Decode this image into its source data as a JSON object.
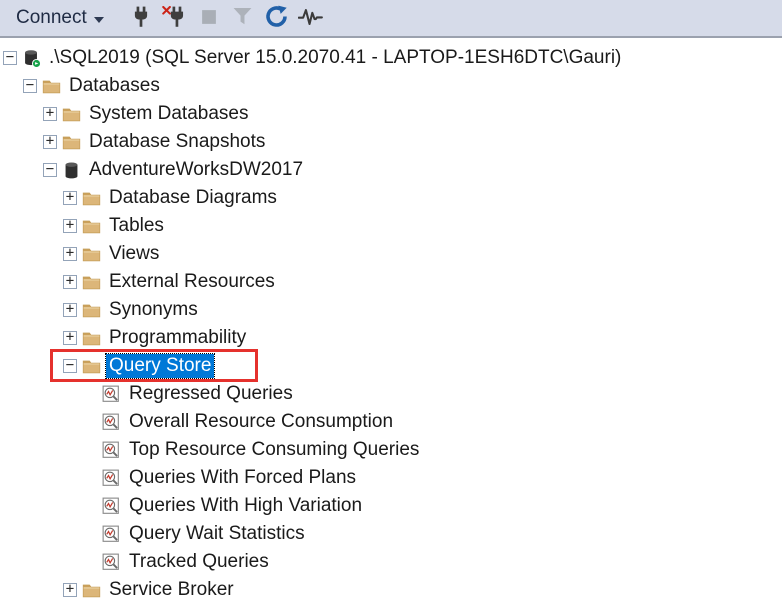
{
  "toolbar": {
    "connect_label": "Connect",
    "buttons": [
      {
        "name": "connect-button",
        "type": "dropdown",
        "label": "Connect",
        "disabled": false
      },
      {
        "name": "connect-object-explorer-button",
        "icon": "plug-icon",
        "disabled": false
      },
      {
        "name": "disconnect-object-explorer-button",
        "icon": "plug-disconnect-icon",
        "disabled": false
      },
      {
        "name": "stop-button",
        "icon": "stop-icon",
        "disabled": true
      },
      {
        "name": "filter-button",
        "icon": "filter-icon",
        "disabled": true
      },
      {
        "name": "refresh-button",
        "icon": "refresh-icon",
        "disabled": false
      },
      {
        "name": "activity-monitor-button",
        "icon": "activity-pulse-icon",
        "disabled": false
      }
    ]
  },
  "colors": {
    "toolbar_bg": "#D6DBE9",
    "selection_bg": "#0078D7",
    "selection_text": "#FFFFFF",
    "annotation_red": "#E5312D",
    "folder_tan": "#DCB679",
    "refresh_blue": "#2160A8"
  },
  "tree": {
    "rows": [
      {
        "level": 0,
        "expand": "minus",
        "icon": "server",
        "label": ".\\SQL2019 (SQL Server 15.0.2070.41 - LAPTOP-1ESH6DTC\\Gauri)"
      },
      {
        "level": 1,
        "expand": "minus",
        "icon": "folder",
        "label": "Databases"
      },
      {
        "level": 2,
        "expand": "plus",
        "icon": "folder",
        "label": "System Databases"
      },
      {
        "level": 2,
        "expand": "plus",
        "icon": "folder",
        "label": "Database Snapshots"
      },
      {
        "level": 2,
        "expand": "minus",
        "icon": "database",
        "label": "AdventureWorksDW2017"
      },
      {
        "level": 3,
        "expand": "plus",
        "icon": "folder",
        "label": "Database Diagrams"
      },
      {
        "level": 3,
        "expand": "plus",
        "icon": "folder",
        "label": "Tables"
      },
      {
        "level": 3,
        "expand": "plus",
        "icon": "folder",
        "label": "Views"
      },
      {
        "level": 3,
        "expand": "plus",
        "icon": "folder",
        "label": "External Resources"
      },
      {
        "level": 3,
        "expand": "plus",
        "icon": "folder",
        "label": "Synonyms"
      },
      {
        "level": 3,
        "expand": "plus",
        "icon": "folder",
        "label": "Programmability"
      },
      {
        "level": 3,
        "expand": "minus",
        "icon": "folder",
        "label": "Query Store",
        "selected": true,
        "annotated": true
      },
      {
        "level": 4,
        "expand": "none",
        "icon": "report",
        "label": "Regressed Queries"
      },
      {
        "level": 4,
        "expand": "none",
        "icon": "report",
        "label": "Overall Resource Consumption"
      },
      {
        "level": 4,
        "expand": "none",
        "icon": "report",
        "label": "Top Resource Consuming Queries"
      },
      {
        "level": 4,
        "expand": "none",
        "icon": "report",
        "label": "Queries With Forced Plans"
      },
      {
        "level": 4,
        "expand": "none",
        "icon": "report",
        "label": "Queries With High Variation"
      },
      {
        "level": 4,
        "expand": "none",
        "icon": "report",
        "label": "Query Wait Statistics"
      },
      {
        "level": 4,
        "expand": "none",
        "icon": "report",
        "label": "Tracked Queries"
      },
      {
        "level": 3,
        "expand": "plus",
        "icon": "folder",
        "label": "Service Broker"
      }
    ]
  }
}
